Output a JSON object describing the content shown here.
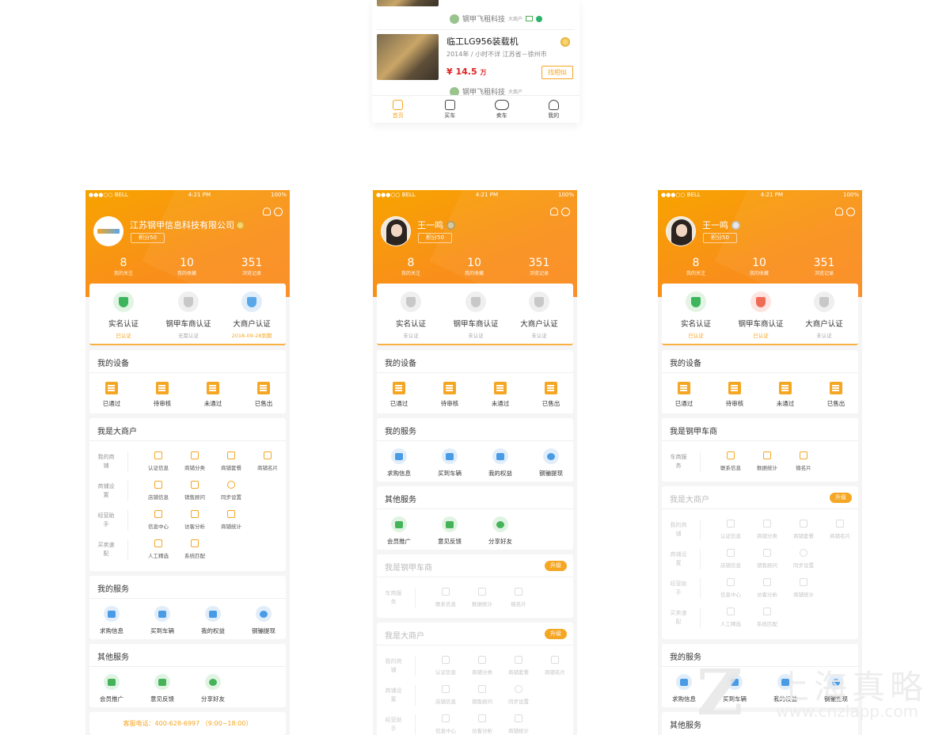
{
  "listing": {
    "seller1": "钢甲飞租科技",
    "badge1": "大商户",
    "item_title": "临工LG956装载机",
    "item_sub": "2014年 / 小时不详 江苏省－徐州市",
    "price": "¥ 14.5",
    "price_unit": "万",
    "find_btn": "找相似",
    "seller2": "钢甲飞租科技",
    "badge2": "大商户",
    "tabs": [
      "首页",
      "买车",
      "卖车",
      "我的"
    ]
  },
  "status": {
    "carrier": "●●●○○ BELL",
    "time": "4:21 PM",
    "battery": "100%"
  },
  "phone1": {
    "name": "江苏钢甲信息科技有限公司",
    "points": "积分50",
    "stats": [
      {
        "n": "8",
        "l": "我的关注"
      },
      {
        "n": "10",
        "l": "我的收藏"
      },
      {
        "n": "351",
        "l": "浏览记录"
      }
    ],
    "certs": [
      {
        "t": "实名认证",
        "s": "已认证"
      },
      {
        "t": "钢甲车商认证",
        "s": "无需认证"
      },
      {
        "t": "大商户认证",
        "s": "2018-09-28到期"
      }
    ],
    "device_title": "我的设备",
    "devices": [
      "已通过",
      "待审核",
      "未通过",
      "已售出"
    ],
    "merchant_title": "我是大商户",
    "groups": [
      {
        "g": "我的商铺",
        "items": [
          "认证信息",
          "商铺分类",
          "商铺套餐",
          "商铺名片"
        ]
      },
      {
        "g": "商铺设置",
        "items": [
          "店铺信息",
          "销售顾问",
          "同步设置"
        ]
      },
      {
        "g": "经营助手",
        "items": [
          "信息中心",
          "访客分析",
          "商铺统计"
        ]
      },
      {
        "g": "买卖速配",
        "items": [
          "人工精选",
          "系统匹配"
        ]
      }
    ],
    "service_title": "我的服务",
    "services": [
      "求购信息",
      "买到车辆",
      "我的权益",
      "钢镚提现"
    ],
    "other_title": "其他服务",
    "others": [
      "会员推广",
      "意见反馈",
      "分享好友"
    ],
    "hotline": "客服电话：400-628-6997 （9:00~18:00）"
  },
  "phone2": {
    "name": "王一鸣",
    "points": "积分50",
    "stats": [
      {
        "n": "8",
        "l": "我的关注"
      },
      {
        "n": "10",
        "l": "我的收藏"
      },
      {
        "n": "351",
        "l": "浏览记录"
      }
    ],
    "certs": [
      {
        "t": "实名认证",
        "s": "未认证"
      },
      {
        "t": "钢甲车商认证",
        "s": "未认证"
      },
      {
        "t": "大商户认证",
        "s": "未认证"
      }
    ],
    "device_title": "我的设备",
    "devices": [
      "已通过",
      "待审核",
      "未通过",
      "已售出"
    ],
    "service_title": "我的服务",
    "services": [
      "求购信息",
      "买到车辆",
      "我的权益",
      "钢镚提现"
    ],
    "other_title": "其他服务",
    "others": [
      "会员推广",
      "意见反馈",
      "分享好友"
    ],
    "dealer_title": "我是钢甲车商",
    "upgrade": "升级",
    "dealer_group": "车商服务",
    "dealer_items": [
      "联系信息",
      "数据统计",
      "微名片"
    ],
    "merchant_title": "我是大商户",
    "groups": [
      {
        "g": "我的商铺",
        "items": [
          "认证信息",
          "商铺分类",
          "商铺套餐",
          "商铺名片"
        ]
      },
      {
        "g": "商铺设置",
        "items": [
          "店铺信息",
          "销售顾问",
          "同步设置"
        ]
      },
      {
        "g": "经营助手",
        "items": [
          "信息中心",
          "访客分析",
          "商铺统计"
        ]
      }
    ]
  },
  "phone3": {
    "name": "王一鸣",
    "points": "积分50",
    "stats": [
      {
        "n": "8",
        "l": "我的关注"
      },
      {
        "n": "10",
        "l": "我的收藏"
      },
      {
        "n": "351",
        "l": "浏览记录"
      }
    ],
    "certs": [
      {
        "t": "实名认证",
        "s": "已认证"
      },
      {
        "t": "钢甲车商认证",
        "s": "已认证"
      },
      {
        "t": "大商户认证",
        "s": "未认证"
      }
    ],
    "device_title": "我的设备",
    "devices": [
      "已通过",
      "待审核",
      "未通过",
      "已售出"
    ],
    "dealer_title": "我是钢甲车商",
    "dealer_group": "车商服务",
    "dealer_items": [
      "联系信息",
      "数据统计",
      "微名片"
    ],
    "merchant_title": "我是大商户",
    "upgrade": "升级",
    "groups": [
      {
        "g": "我的商铺",
        "items": [
          "认证信息",
          "商铺分类",
          "商铺套餐",
          "商铺名片"
        ]
      },
      {
        "g": "商铺设置",
        "items": [
          "店铺信息",
          "销售顾问",
          "同步设置"
        ]
      },
      {
        "g": "经营助手",
        "items": [
          "信息中心",
          "访客分析",
          "商铺统计"
        ]
      },
      {
        "g": "买卖速配",
        "items": [
          "人工精选",
          "系统匹配"
        ]
      }
    ],
    "service_title": "我的服务",
    "services": [
      "求购信息",
      "买到车辆",
      "我的权益",
      "钢镚提现"
    ],
    "other_title": "其他服务"
  },
  "watermark": {
    "cn": "上海真略",
    "url": "www.cnzlapp.com"
  }
}
